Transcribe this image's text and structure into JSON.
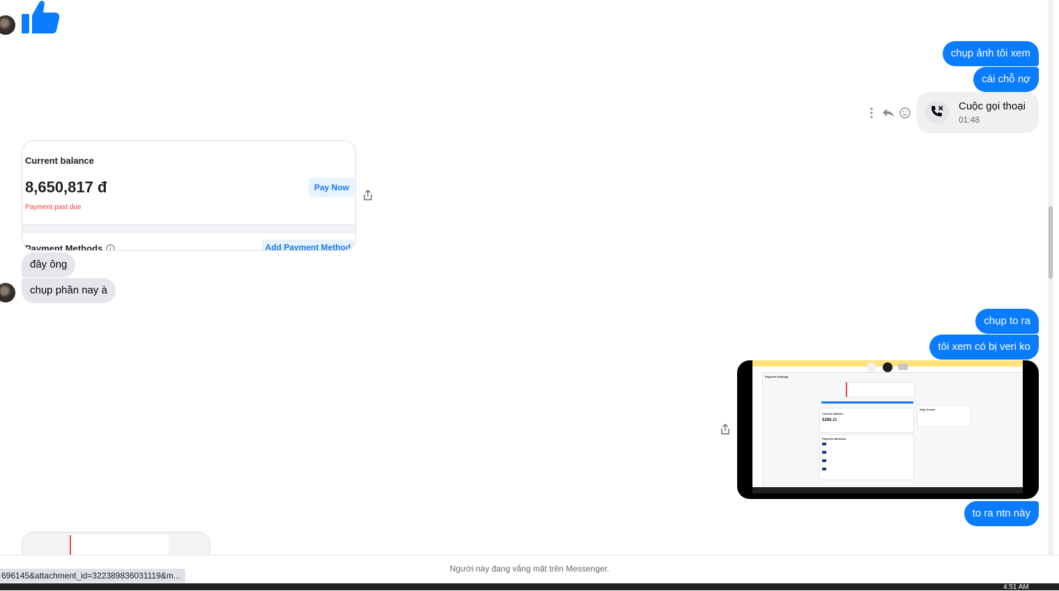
{
  "messages": {
    "out_1": "chụp ảnh tôi xem",
    "out_2": "cái chỗ nợ",
    "call": {
      "title": "Cuộc gọi thoại",
      "duration": "01:48"
    },
    "in_1": "đây ông",
    "in_2": "chụp phần nay à",
    "out_3": "chụp to ra",
    "out_4": "tôi xem có bị veri ko",
    "out_5": "to ra ntn này"
  },
  "balance_card": {
    "label": "Current balance",
    "amount": "8,650,817 đ",
    "status": "Payment past due",
    "pay_button": "Pay Now",
    "payment_methods": "Payment Methods",
    "add_button": "Add Payment Method"
  },
  "screenshot_attachment": {
    "page_title": "Payment Settings",
    "current_balance_label": "Current balance",
    "current_balance_value": "$286.11",
    "payment_methods_label": "Payment Methods",
    "help_label": "Help Center"
  },
  "footer": {
    "status": "Người này đang vắng mặt trên Messenger."
  },
  "url_hover": "696145&attachment_id=322389836031119&m...",
  "system": {
    "clock": "4:51 AM"
  },
  "colors": {
    "outgoing_bubble": "#0a7cff",
    "incoming_bubble": "#e4e6eb",
    "like_icon": "#0a7cff",
    "past_due": "#fa383e"
  },
  "icons": [
    "thumbs-up-icon",
    "more-icon",
    "reply-icon",
    "emoji-icon",
    "missed-call-icon",
    "share-icon",
    "info-icon"
  ]
}
